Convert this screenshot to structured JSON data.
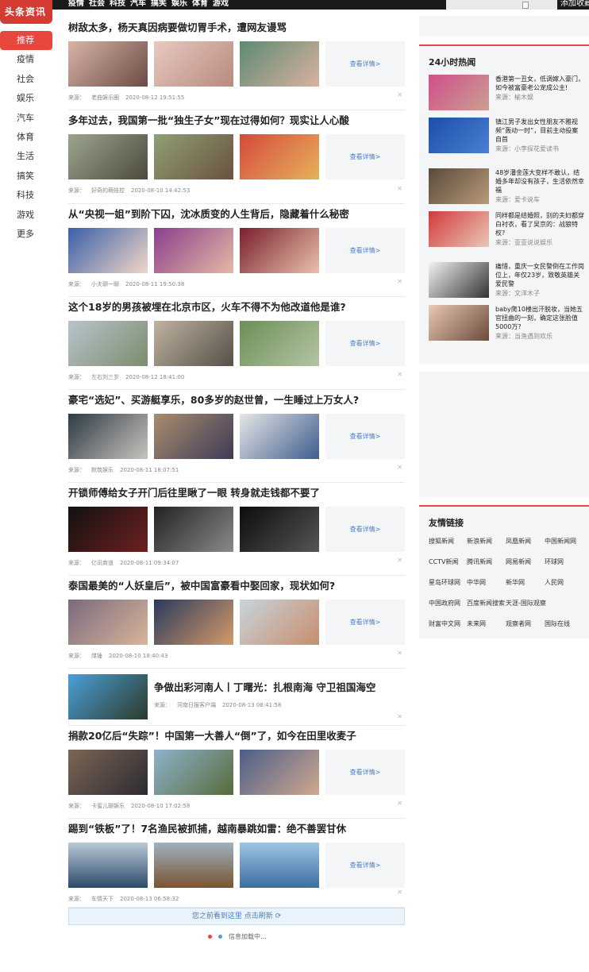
{
  "topnav": [
    "疫情",
    "社会",
    "科技",
    "汽车",
    "搞笑",
    "娱乐",
    "体育",
    "游戏"
  ],
  "top_add": "添加收藏",
  "logo": "头条资讯",
  "sidenav": [
    "推荐",
    "疫情",
    "社会",
    "娱乐",
    "汽车",
    "体育",
    "生活",
    "搞笑",
    "科技",
    "游戏",
    "更多"
  ],
  "more_label": "查看详情>",
  "source_label": "来源：",
  "feed": [
    {
      "title": "树敌太多，杨天真因病要做切胃手术，遭网友谩骂",
      "source": "老曲娱乐圈",
      "time": "2020-08-12 19:51:55"
    },
    {
      "title": "多年过去，我国第一批“独生子女”现在过得如何？现实让人心酸",
      "source": "好奇的萌娃控",
      "time": "2020-08-10 14:42:53"
    },
    {
      "title": "从“央视一姐”到阶下囚，沈冰质变的人生背后，隐藏着什么秘密",
      "source": "小夫聊一聊",
      "time": "2020-08-11 19:50:38"
    },
    {
      "title": "这个18岁的男孩被埋在北京市区，火车不得不为他改道他是谁?",
      "source": "左右刘三岁",
      "time": "2020-08-12 18:41:00"
    },
    {
      "title": "豪宅“选妃”、买游艇享乐，80多岁的赵世曾，一生睡过上万女人?",
      "source": "默筑娱乐",
      "time": "2020-08-11 18:07:51"
    },
    {
      "title": "开锁师傅给女子开门后往里瞅了一眼 转身就走钱都不要了",
      "source": "亿讯商道",
      "time": "2020-08-11 09:34:07"
    },
    {
      "title": "泰国最美的“人妖皇后”，被中国富豪看中娶回家，现状如何?",
      "source": "煤锤",
      "time": "2020-08-10 18:40:43"
    },
    {
      "title": "争做出彩河南人丨丁曙光：扎根南海 守卫祖国海空",
      "source": "河南日报客户端",
      "time": "2020-08-13 08:41:58"
    },
    {
      "title": "捐款20亿后“失踪”！中国第一大善人“倒”了，如今在田里收麦子",
      "source": "卡蜜儿聊娱乐",
      "time": "2020-08-10 17:02:58"
    },
    {
      "title": "踢到“铁板”了！7名渔民被抓捕，越南暴跳如雷：绝不善罢甘休",
      "source": "车情天下",
      "time": "2020-08-13 06:58:32"
    }
  ],
  "seen_bar": "您之前看到这里  点击刷新",
  "loading": "信息加载中...",
  "hot": {
    "title": "24小时热闻",
    "items": [
      {
        "text": "香港第一丑女，低调嫁入豪门，如今被富豪老公宠成公主!",
        "source": "榆木娱"
      },
      {
        "text": "镇江男子发出女性朋友不雅视频“轰动一时”，目前主动投案自首",
        "source": "小李探花爱读书"
      },
      {
        "text": "48岁潘金莲大变样不敢认，结婚多年却没有孩子，生活依然幸福",
        "source": "爱卡说车"
      },
      {
        "text": "同样都是结婚照，别的夫妇都穿白衬衣，看了吴京的：战狼特权?",
        "source": "亚亚说说娱乐"
      },
      {
        "text": "痛惜，重庆一女民警倒在工作岗位上，年仅23岁，致敬英雄关爱民警",
        "source": "文洋木子"
      },
      {
        "text": "baby爬10楼出汗脱妆，当她五官扭曲的一刻，确定这张脸值5000万?",
        "source": "当渔遇到欢乐"
      }
    ]
  },
  "links": {
    "title": "友情链接",
    "items": [
      "搜狐新闻",
      "新浪新闻",
      "凤凰新闻",
      "中国新闻网",
      "CCTV新闻",
      "腾讯新闻",
      "网易新闻",
      "环球网",
      "星岛环球网",
      "中华网",
      "新华网",
      "人民网",
      "中国政府网",
      "百度新闻搜索",
      "天涯-国际观察",
      "财富中文网",
      "未来网",
      "观察者网",
      "国际在线"
    ]
  }
}
